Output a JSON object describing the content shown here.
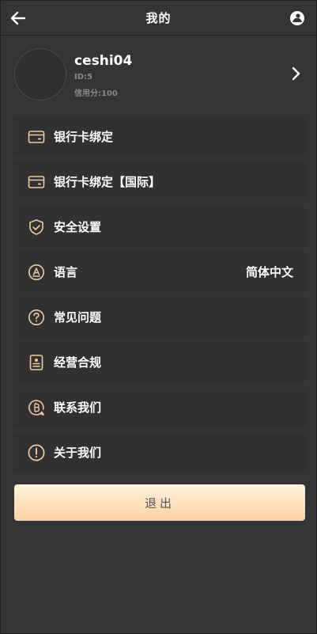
{
  "header": {
    "title": "我的",
    "back_icon": "arrow-left-icon",
    "right_icon": "user-silhouette-icon"
  },
  "profile": {
    "username": "ceshi04",
    "id_text": "ID:5",
    "credit_text": "信用分:100",
    "arrow_icon": "chevron-right-icon"
  },
  "menu": {
    "items": [
      {
        "label": "银行卡绑定",
        "icon": "bank-card-icon"
      },
      {
        "label": "银行卡绑定【国际】",
        "icon": "bank-card-icon"
      },
      {
        "label": "安全设置",
        "icon": "shield-check-icon"
      },
      {
        "label": "语言",
        "value": "简体中文",
        "icon": "language-icon"
      },
      {
        "label": "常见问题",
        "icon": "question-icon"
      },
      {
        "label": "经营合规",
        "icon": "document-user-icon"
      },
      {
        "label": "联系我们",
        "icon": "bitcoin-chat-icon"
      },
      {
        "label": "关于我们",
        "icon": "exclamation-icon"
      }
    ]
  },
  "logout": {
    "label": "退出"
  },
  "colors": {
    "background": "#343434",
    "accent": "#f2c99a",
    "logout_gradient_top": "#fff1dd",
    "logout_gradient_bottom": "#ffd3a2"
  }
}
